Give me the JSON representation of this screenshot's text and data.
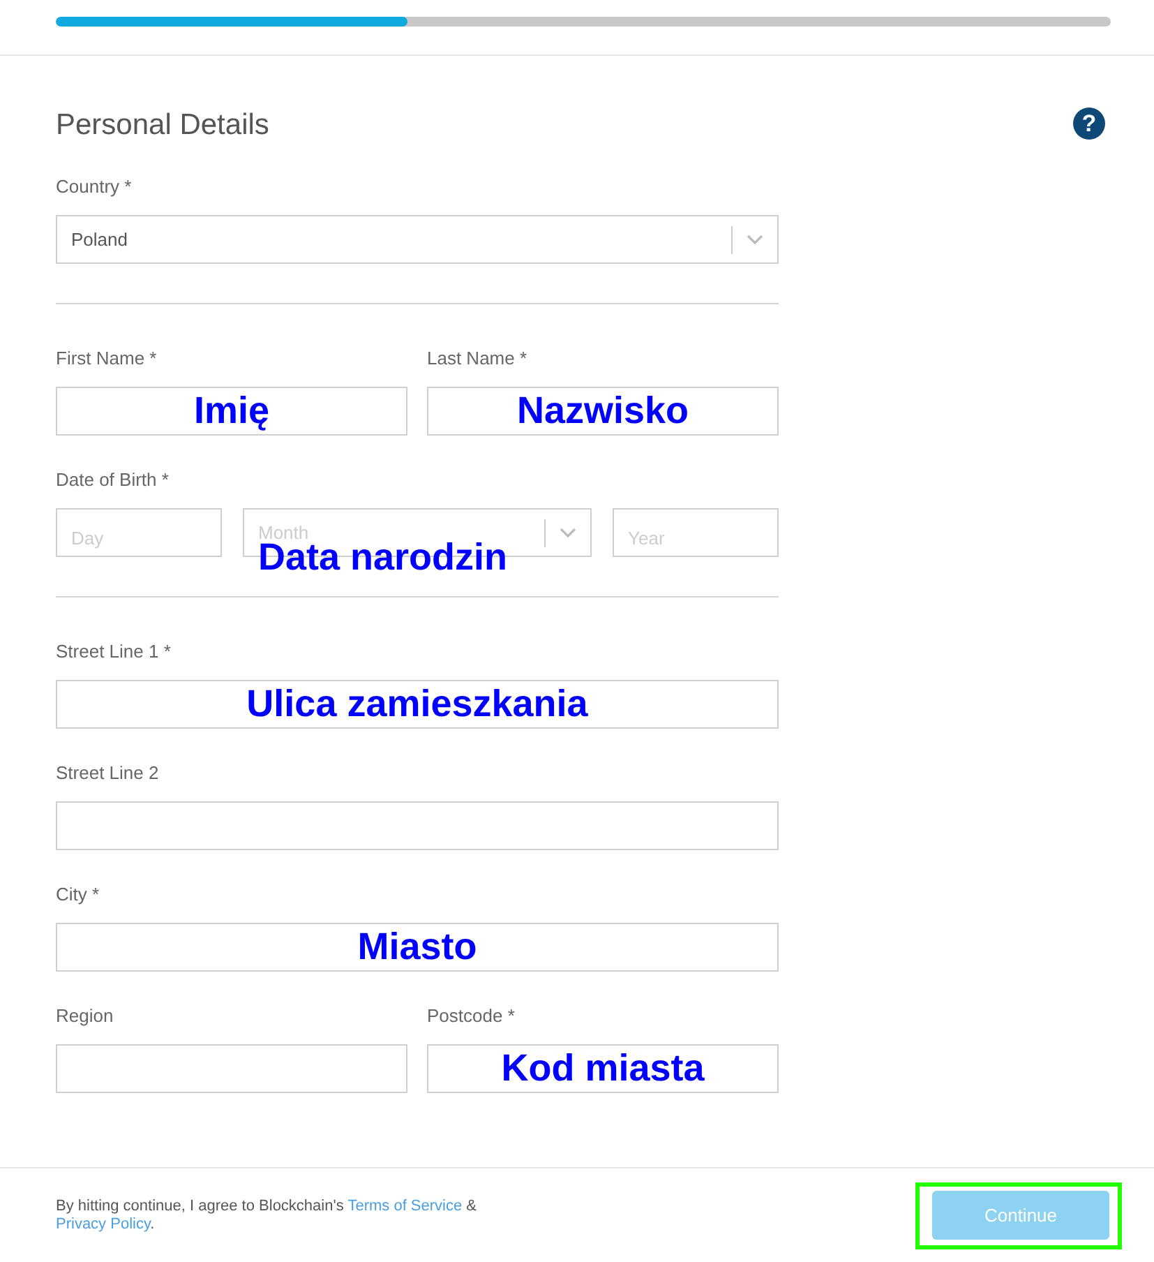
{
  "progress": {
    "level": 0.333
  },
  "title": "Personal Details",
  "help": "?",
  "country": {
    "label": "Country *",
    "value": "Poland"
  },
  "rows": [
    {
      "kind": "pair",
      "fields": [
        {
          "label": "First Name *",
          "value": "Imię"
        },
        {
          "label": "Last Name *",
          "value": "Nazwisko"
        }
      ]
    },
    {
      "kind": "date",
      "label": "Date of Birth *",
      "day": {
        "placeholder": "Day"
      },
      "month": {
        "placeholder": "Month"
      },
      "year": {
        "placeholder": "Year"
      },
      "annotation": "Data narodzin"
    },
    {
      "kind": "divider"
    },
    {
      "kind": "single",
      "fields": [
        {
          "label": "Street Line 1 *",
          "value": "Ulica zamieszkania"
        }
      ]
    },
    {
      "kind": "single",
      "fields": [
        {
          "label": "Street Line 2"
        }
      ]
    },
    {
      "kind": "single",
      "fields": [
        {
          "label": "City *",
          "value": "Miasto"
        }
      ]
    },
    {
      "kind": "pair",
      "fields": [
        {
          "label": "Region"
        },
        {
          "label": "Postcode *",
          "value": "Kod miasta"
        }
      ]
    }
  ],
  "footer": {
    "text": "By hitting continue, I agree to Blockchain's ",
    "terms": "Terms of Service",
    "amp": " &",
    "privacy": "Privacy Policy",
    "end": ".",
    "button": {
      "label": "Continue",
      "disabled": true,
      "highlighted": true
    }
  }
}
